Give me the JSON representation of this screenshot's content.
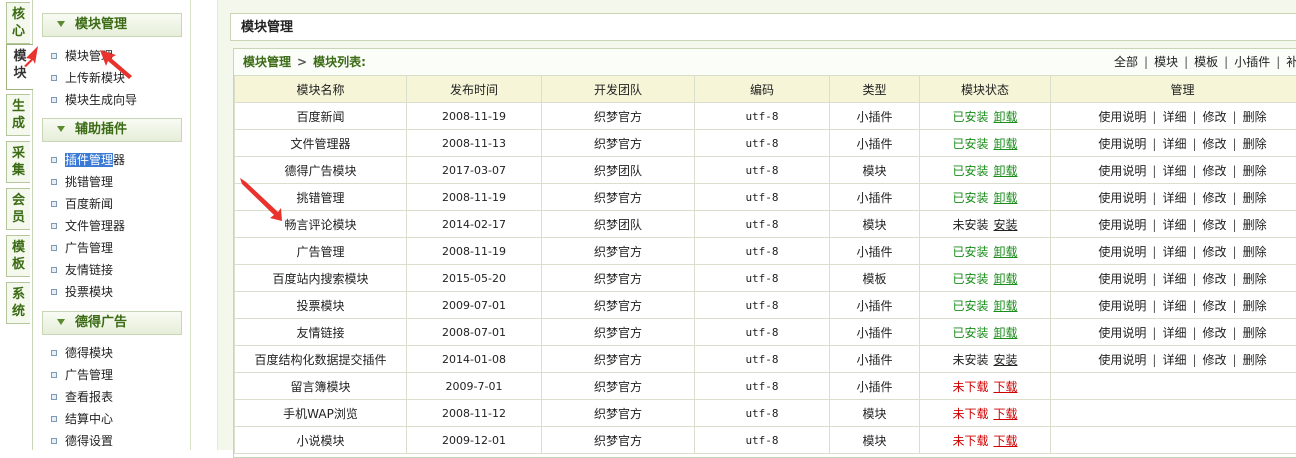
{
  "vtabs": [
    {
      "chars": [
        "核",
        "心"
      ],
      "active": false
    },
    {
      "chars": [
        "模",
        "块"
      ],
      "active": true
    },
    {
      "chars": [
        "生",
        "成"
      ],
      "active": false
    },
    {
      "chars": [
        "采",
        "集"
      ],
      "active": false
    },
    {
      "chars": [
        "会",
        "员"
      ],
      "active": false
    },
    {
      "chars": [
        "模",
        "板"
      ],
      "active": false
    },
    {
      "chars": [
        "系",
        "统"
      ],
      "active": false
    }
  ],
  "menu": {
    "sections": [
      {
        "title": "模块管理",
        "items": [
          "模块管理",
          "上传新模块",
          "模块生成向导"
        ]
      },
      {
        "title": "辅助插件",
        "items": [
          "插件管理器",
          "挑错管理",
          "百度新闻",
          "文件管理器",
          "广告管理",
          "友情链接",
          "投票模块"
        ]
      },
      {
        "title": "德得广告",
        "items": [
          "德得模块",
          "广告管理",
          "查看报表",
          "结算中心",
          "德得设置"
        ]
      }
    ],
    "highlight_part": "插件管理",
    "highlight_rest": "器"
  },
  "main": {
    "title": "模块管理",
    "breadcrumb": {
      "root": "模块管理",
      "sep": ">",
      "current": "模块列表:"
    },
    "filters": [
      "全部",
      "模块",
      "模板",
      "小插件",
      "补"
    ]
  },
  "table": {
    "headers": [
      "模块名称",
      "发布时间",
      "开发团队",
      "编码",
      "类型",
      "模块状态",
      "管理"
    ],
    "manage_links": [
      "使用说明",
      "详细",
      "修改",
      "删除"
    ],
    "rows": [
      {
        "name": "百度新闻",
        "date": "2008-11-19",
        "team": "织梦官方",
        "enc": "utf-8",
        "type": "小插件",
        "status": "已安装",
        "action": "卸载",
        "state": "installed"
      },
      {
        "name": "文件管理器",
        "date": "2008-11-13",
        "team": "织梦官方",
        "enc": "utf-8",
        "type": "小插件",
        "status": "已安装",
        "action": "卸载",
        "state": "installed"
      },
      {
        "name": "德得广告模块",
        "date": "2017-03-07",
        "team": "织梦团队",
        "enc": "utf-8",
        "type": "模块",
        "status": "已安装",
        "action": "卸载",
        "state": "installed"
      },
      {
        "name": "挑错管理",
        "date": "2008-11-19",
        "team": "织梦官方",
        "enc": "utf-8",
        "type": "小插件",
        "status": "已安装",
        "action": "卸载",
        "state": "installed"
      },
      {
        "name": "畅言评论模块",
        "date": "2014-02-17",
        "team": "织梦团队",
        "enc": "utf-8",
        "type": "模块",
        "status": "未安装",
        "action": "安装",
        "state": "uninstalled"
      },
      {
        "name": "广告管理",
        "date": "2008-11-19",
        "team": "织梦官方",
        "enc": "utf-8",
        "type": "小插件",
        "status": "已安装",
        "action": "卸载",
        "state": "installed"
      },
      {
        "name": "百度站内搜索模块",
        "date": "2015-05-20",
        "team": "织梦官方",
        "enc": "utf-8",
        "type": "模板",
        "status": "已安装",
        "action": "卸载",
        "state": "installed"
      },
      {
        "name": "投票模块",
        "date": "2009-07-01",
        "team": "织梦官方",
        "enc": "utf-8",
        "type": "小插件",
        "status": "已安装",
        "action": "卸载",
        "state": "installed"
      },
      {
        "name": "友情链接",
        "date": "2008-07-01",
        "team": "织梦官方",
        "enc": "utf-8",
        "type": "小插件",
        "status": "已安装",
        "action": "卸载",
        "state": "installed"
      },
      {
        "name": "百度结构化数据提交插件",
        "date": "2014-01-08",
        "team": "织梦官方",
        "enc": "utf-8",
        "type": "小插件",
        "status": "未安装",
        "action": "安装",
        "state": "uninstalled"
      },
      {
        "name": "留言簿模块",
        "date": "2009-7-01",
        "team": "织梦官方",
        "enc": "utf-8",
        "type": "小插件",
        "status": "未下载",
        "action": "下载",
        "state": "notdl"
      },
      {
        "name": "手机WAP浏览",
        "date": "2008-11-12",
        "team": "织梦官方",
        "enc": "utf-8",
        "type": "模块",
        "status": "未下载",
        "action": "下载",
        "state": "notdl"
      },
      {
        "name": "小说模块",
        "date": "2009-12-01",
        "team": "织梦官方",
        "enc": "utf-8",
        "type": "模块",
        "status": "未下载",
        "action": "下载",
        "state": "notdl"
      }
    ]
  },
  "colors": {
    "accent_green": "#3b6b15",
    "installed": "#1a8c1a",
    "not_downloaded": "#d00000",
    "arrow": "#e8322d"
  }
}
